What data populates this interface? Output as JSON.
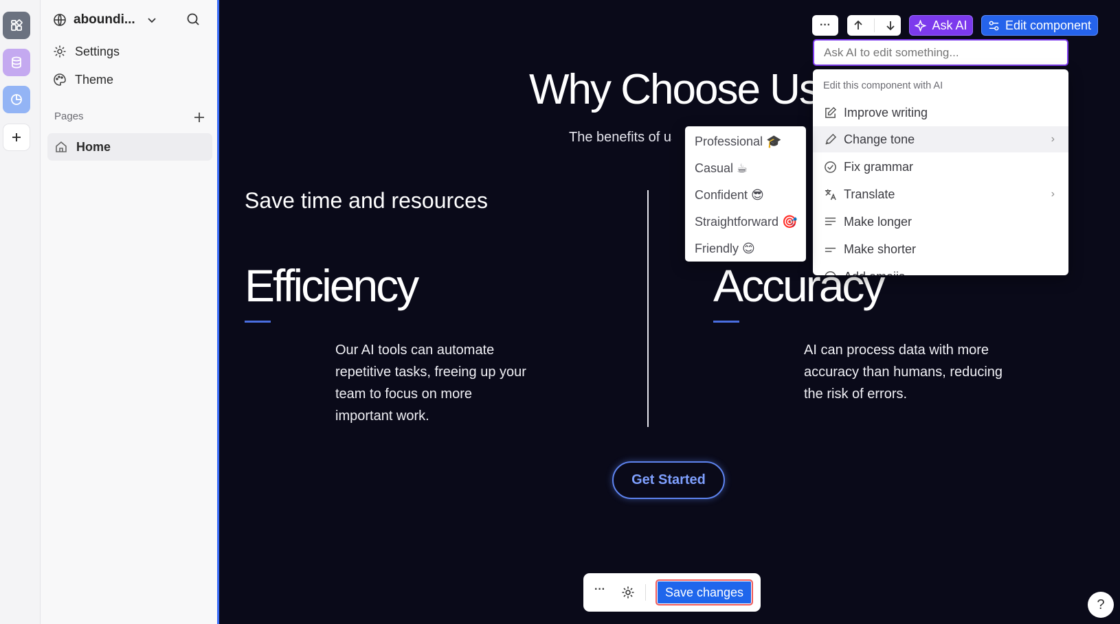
{
  "sidebar": {
    "site_name": "aboundi...",
    "nav": [
      {
        "label": "Settings"
      },
      {
        "label": "Theme"
      }
    ],
    "pages_label": "Pages",
    "pages": [
      {
        "label": "Home"
      }
    ]
  },
  "canvas": {
    "title": "Why Choose Us",
    "subtitle": "The benefits of usi",
    "section_label": "Save time and resources",
    "columns": [
      {
        "title": "Efficiency",
        "text_lines": [
          "Our AI tools can automate",
          "repetitive tasks, freeing up your",
          "team to focus on more",
          "important work."
        ]
      },
      {
        "title": "Accuracy",
        "text_lines": [
          "AI can process data with more",
          "accuracy than humans, reducing",
          "the risk of errors."
        ]
      }
    ],
    "cta": "Get Started"
  },
  "toolbar": {
    "more_label": "···",
    "ask_ai_label": "Ask AI",
    "edit_component_label": "Edit component"
  },
  "ai_panel": {
    "input_placeholder": "Ask AI to edit something...",
    "menu_header": "Edit this component with AI",
    "items": [
      {
        "label": "Improve writing",
        "icon": "pencil-square-icon"
      },
      {
        "label": "Change tone",
        "icon": "pen-nib-icon"
      },
      {
        "label": "Fix grammar",
        "icon": "check-circle-icon"
      },
      {
        "label": "Translate",
        "icon": "translate-icon"
      },
      {
        "label": "Make longer",
        "icon": "align-left-icon"
      },
      {
        "label": "Make shorter",
        "icon": "short-lines-icon"
      },
      {
        "label": "Add emojis",
        "icon": "smiley-icon"
      }
    ],
    "tones": [
      {
        "label": "Professional 🎓"
      },
      {
        "label": "Casual ☕"
      },
      {
        "label": "Confident 😎"
      },
      {
        "label": "Straightforward 🎯"
      },
      {
        "label": "Friendly 😊"
      }
    ]
  },
  "bottom_bar": {
    "more_label": "···",
    "save_label": "Save changes"
  },
  "help_label": "?",
  "colors": {
    "accent_purple": "#7c3aed",
    "accent_blue": "#2563eb",
    "canvas_bg": "#0a0a19"
  }
}
